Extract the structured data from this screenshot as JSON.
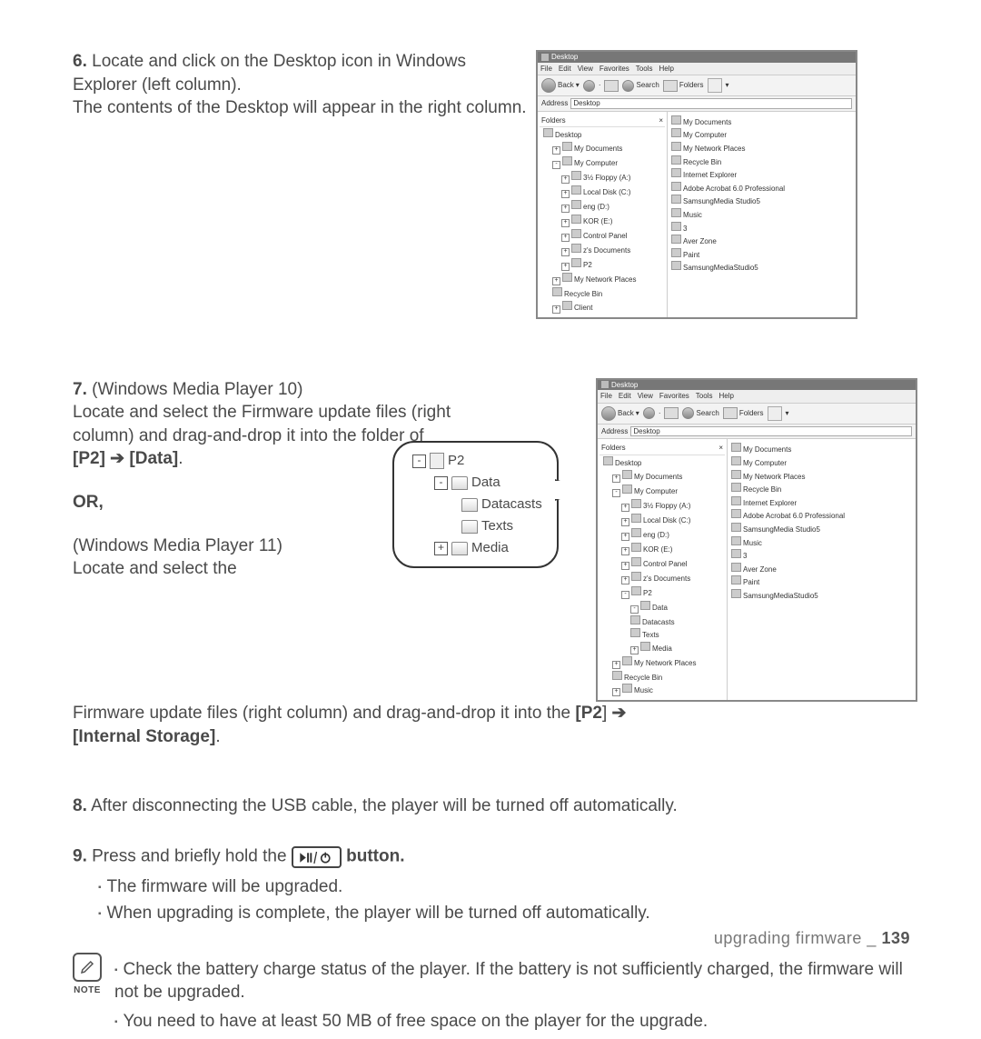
{
  "step6": {
    "num": "6.",
    "line1": " Locate and click on the Desktop icon in Windows Explorer (left column).",
    "line2": "The contents of the Desktop will appear in the right column."
  },
  "step7": {
    "num": "7.",
    "wmp10": " (Windows Media Player 10)",
    "body1": "Locate and select the Firmware update files (right column) and drag-and-drop it into the folder of ",
    "p2": "[P2]",
    "arrow1": " ➔ ",
    "data": "[Data]",
    "period": ".",
    "or": "OR,",
    "wmp11a": "(Windows Media Player 11)",
    "wmp11b": "Locate and select the",
    "cont": "Firmware update files (right column) and drag-and-drop it into the ",
    "p2b": "[P2",
    "bracket": "]",
    "arrow2": " ➔ ",
    "internal": "[Internal Storage]",
    "period2": "."
  },
  "step8": {
    "num": "8.",
    "text": " After disconnecting the USB cable, the player will be turned off automatically."
  },
  "step9": {
    "num": "9.",
    "pre": " Press and briefly hold the ",
    "post": " button.",
    "b1": "The firmware will be upgraded.",
    "b2": "When upgrading is complete, the player will be turned off automatically."
  },
  "note": {
    "label": "NOTE",
    "b1": "Check the battery charge status of the player. If the battery is not sufficiently charged, the firmware will not be upgraded.",
    "b2": "You need to have at least 50 MB of free space on the player for the upgrade."
  },
  "footer": {
    "text": "upgrading firmware _ ",
    "page": "139"
  },
  "explorer1": {
    "title": "Desktop",
    "menu": [
      "File",
      "Edit",
      "View",
      "Favorites",
      "Tools",
      "Help"
    ],
    "toolbar": {
      "back": "Back",
      "search": "Search",
      "folders": "Folders"
    },
    "address_label": "Address",
    "address_value": "Desktop",
    "tree_hdr": "Folders",
    "tree": [
      "Desktop",
      "My Documents",
      "My Computer",
      "3½ Floppy (A:)",
      "Local Disk (C:)",
      "eng (D:)",
      "KOR (E:)",
      "Control Panel",
      "z's Documents",
      "P2",
      "My Network Places",
      "Recycle Bin",
      "Client"
    ],
    "list": [
      "My Documents",
      "My Computer",
      "My Network Places",
      "Recycle Bin",
      "Internet Explorer",
      "Adobe Acrobat 6.0 Professional",
      "SamsungMedia Studio5",
      "Music",
      "3",
      "Aver Zone",
      "Paint",
      "SamsungMediaStudio5"
    ]
  },
  "explorer2": {
    "title": "Desktop",
    "menu": [
      "File",
      "Edit",
      "View",
      "Favorites",
      "Tools",
      "Help"
    ],
    "toolbar": {
      "back": "Back",
      "search": "Search",
      "folders": "Folders"
    },
    "address_label": "Address",
    "address_value": "Desktop",
    "tree_hdr": "Folders",
    "tree": [
      "Desktop",
      "My Documents",
      "My Computer",
      "3½ Floppy (A:)",
      "Local Disk (C:)",
      "eng (D:)",
      "KOR (E:)",
      "Control Panel",
      "z's Documents",
      "P2",
      "Data",
      "Datacasts",
      "Texts",
      "Media",
      "My Network Places",
      "Recycle Bin",
      "Music"
    ],
    "list": [
      "My Documents",
      "My Computer",
      "My Network Places",
      "Recycle Bin",
      "Internet Explorer",
      "Adobe Acrobat 6.0 Professional",
      "SamsungMedia Studio5",
      "Music",
      "3",
      "Aver Zone",
      "Paint",
      "SamsungMediaStudio5"
    ]
  },
  "bubble": {
    "p2": "P2",
    "data": "Data",
    "datacasts": "Datacasts",
    "texts": "Texts",
    "media": "Media"
  }
}
